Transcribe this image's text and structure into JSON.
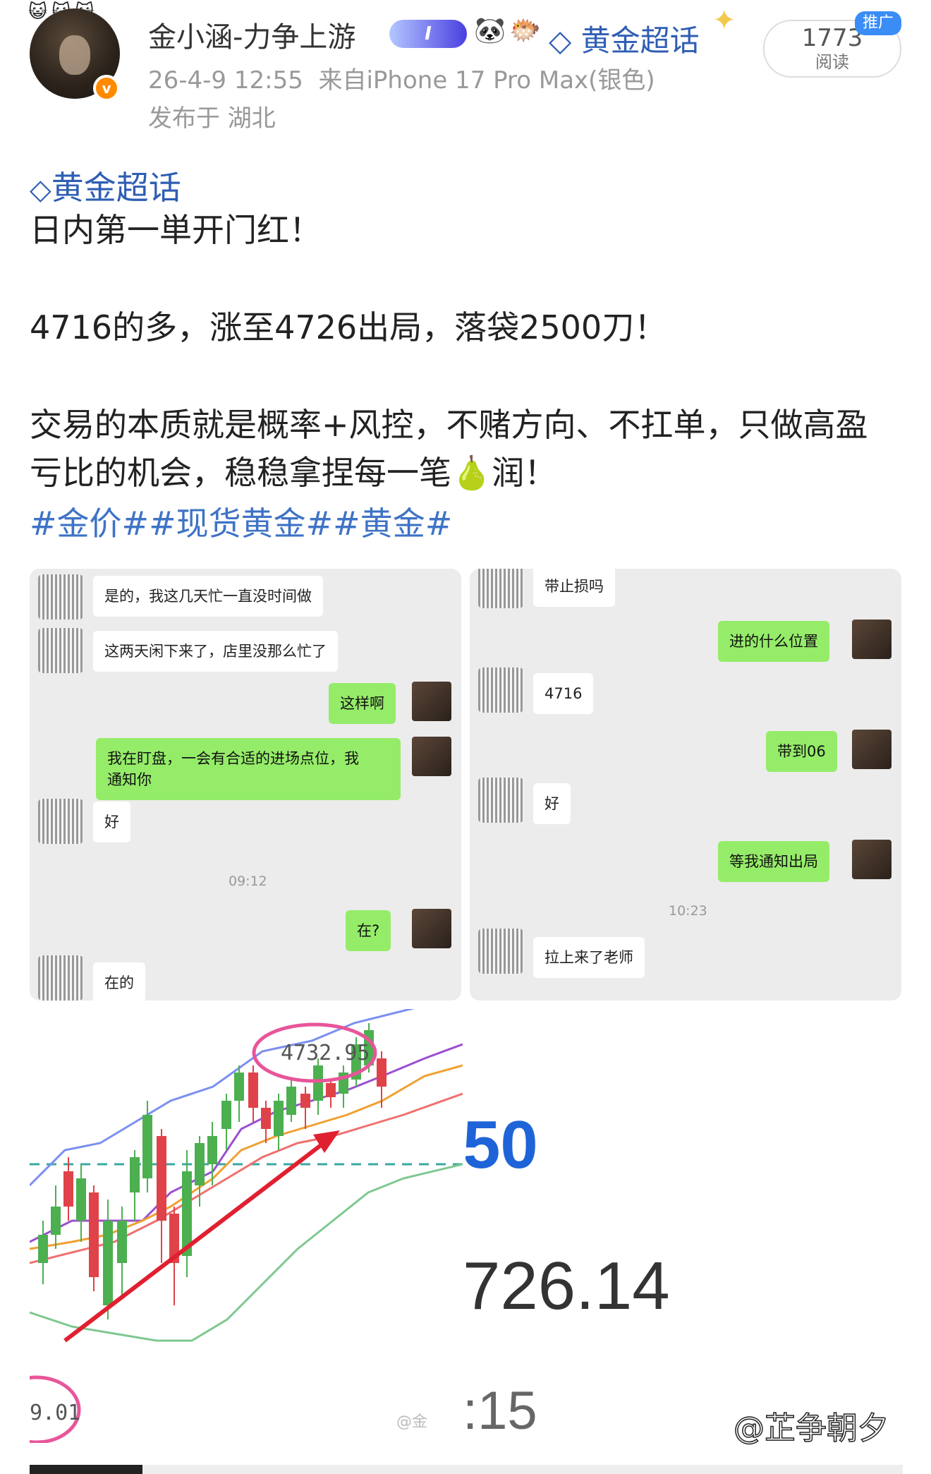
{
  "header": {
    "username": "金小涵-力争上游",
    "level_chip": "I",
    "supertopic": "黄金超话",
    "timestamp": "26-4-9 12:55",
    "source": "来自iPhone 17 Pro Max(银色)",
    "location": "发布于 湖北",
    "reads": "1773",
    "reads_label": "阅读",
    "promo_badge": "推广"
  },
  "post": {
    "topic": "黄金超话",
    "line1": "日内第一単开门红！",
    "line2": "4716的多，涨至4726出局，落袋2500刀！",
    "line3": "交易的本质就是概率+风控，不赌方向、不扛单，只做高盈",
    "line4": "亏比的机会，稳稳拿捏每一笔",
    "line4_end": "润！",
    "tags": "#金价##现货黄金##黄金#"
  },
  "chat_left": {
    "m1": "是的，我这几天忙一直没时间做",
    "m2": "这两天闲下来了，店里没那么忙了",
    "m3": "这样啊",
    "m4a": "我在盯盘，一会有合适的进场点位，我",
    "m4b": "通知你",
    "m5": "好",
    "time": "09:12",
    "m6": "在?",
    "m7": "在的"
  },
  "chat_right": {
    "m1": "带止损吗",
    "m2": "进的什么位置",
    "m3": "4716",
    "m4": "带到06",
    "m5": "好",
    "m6": "等我通知出局",
    "time": "10:23",
    "m7": "拉上来了老师"
  },
  "chart": {
    "high_label": "4732.95",
    "low_label": "9.01",
    "watermark_small": "@金"
  },
  "crop_right": {
    "v1": "50",
    "v2": "726.14",
    "v3": ":15"
  },
  "watermark": "@芷争朝夕",
  "colors": {
    "link": "#2f5eb3",
    "tag": "#3e73c6",
    "green_bubble": "#95ec69",
    "candle_up": "#4caf50",
    "candle_down": "#e0424a",
    "circle": "#e8559a",
    "big_blue": "#1e64d8"
  }
}
